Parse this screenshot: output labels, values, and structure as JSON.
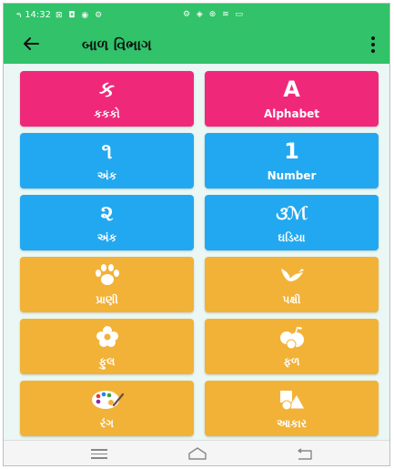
{
  "status_bar": {
    "signal": "⁴⁶ᵢₗₗ",
    "time": "14:32",
    "left_icons": "⊠ ◘ ◉ ⚙",
    "right_icons": "⚙ ◈ ⊛ ≋ ▭"
  },
  "app_bar": {
    "title": "બાળ વિભાગ",
    "back_icon": "arrow-left-icon",
    "menu_icon": "more-vert-icon"
  },
  "colors": {
    "app_bar": "#31c26a",
    "background": "#eaf7f4",
    "pink": "#f0287a",
    "blue": "#22a8f0",
    "orange": "#f2b237"
  },
  "tiles": [
    {
      "glyph": "ક",
      "label": "કકકો",
      "icon": "gujarati-ka-letter",
      "color": "pink"
    },
    {
      "glyph": "A",
      "label": "Alphabet",
      "icon": "latin-a-letter",
      "color": "pink"
    },
    {
      "glyph": "૧",
      "label": "અંક",
      "icon": "gujarati-digit-one",
      "color": "blue"
    },
    {
      "glyph": "1",
      "label": "Number",
      "icon": "digit-one",
      "color": "blue"
    },
    {
      "glyph": "૨",
      "label": "અંક",
      "icon": "gujarati-digit-two",
      "color": "blue"
    },
    {
      "glyph": "૩ℳ",
      "label": "ઘડિયા",
      "icon": "multiplication-table-icon",
      "color": "blue"
    },
    {
      "glyph": "",
      "label": "પ્રાણી",
      "icon": "paw-icon",
      "color": "orange"
    },
    {
      "glyph": "",
      "label": "પક્ષી",
      "icon": "bird-icon",
      "color": "orange"
    },
    {
      "glyph": "",
      "label": "ફુલ",
      "icon": "flower-icon",
      "color": "orange"
    },
    {
      "glyph": "",
      "label": "ફળ",
      "icon": "fruits-icon",
      "color": "orange"
    },
    {
      "glyph": "",
      "label": "રંગ",
      "icon": "palette-icon",
      "color": "orange"
    },
    {
      "glyph": "",
      "label": "આકાર",
      "icon": "shapes-icon",
      "color": "orange"
    }
  ],
  "nav_bar": {
    "recent_icon": "recent-apps-icon",
    "home_icon": "home-icon",
    "back_icon": "nav-back-icon"
  }
}
